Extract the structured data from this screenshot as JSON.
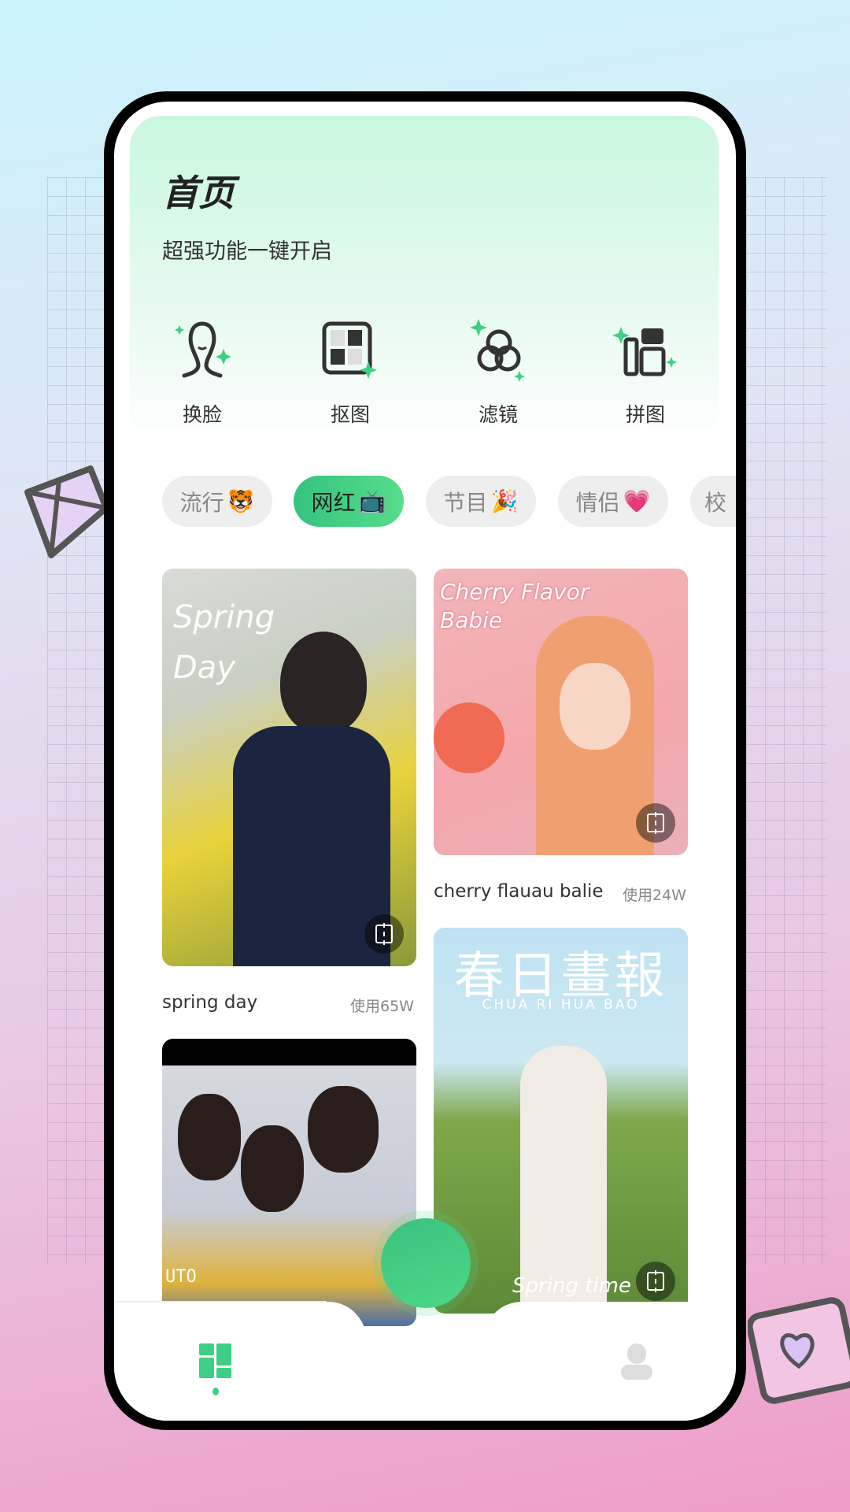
{
  "header": {
    "title": "首页",
    "subtitle": "超强功能一键开启"
  },
  "features": [
    {
      "label": "换脸",
      "icon": "face-swap-icon"
    },
    {
      "label": "抠图",
      "icon": "cutout-icon"
    },
    {
      "label": "滤镜",
      "icon": "filter-icon"
    },
    {
      "label": "拼图",
      "icon": "collage-icon"
    }
  ],
  "categories": [
    {
      "label": "流行",
      "emoji": "🐯",
      "active": false
    },
    {
      "label": "网红",
      "emoji": "📺",
      "active": true
    },
    {
      "label": "节目",
      "emoji": "🎉",
      "active": false
    },
    {
      "label": "情侣",
      "emoji": "💗",
      "active": false
    },
    {
      "label": "校",
      "emoji": "",
      "active": false
    }
  ],
  "templates": [
    {
      "title": "spring day",
      "uses": "使用65W",
      "overlay": "Spring Day"
    },
    {
      "title": "cherry flauau balie",
      "uses": "使用24W",
      "overlay": "Cherry Flavor Babie"
    },
    {
      "title": "",
      "uses": "",
      "overlay": "春日畫報",
      "overlay_sub": "CHUA  RI  HUA  BAO",
      "overlay_foot": "Spring time"
    },
    {
      "title": "",
      "uses": "",
      "overlay": "UTO"
    }
  ],
  "colors": {
    "accent": "#3fcf84",
    "background_top": "#c9f3fb",
    "background_bottom": "#ee9cc8"
  },
  "nav": {
    "items": [
      {
        "icon": "home-grid-icon",
        "active": true
      },
      {
        "icon": "profile-icon",
        "active": false
      }
    ]
  }
}
